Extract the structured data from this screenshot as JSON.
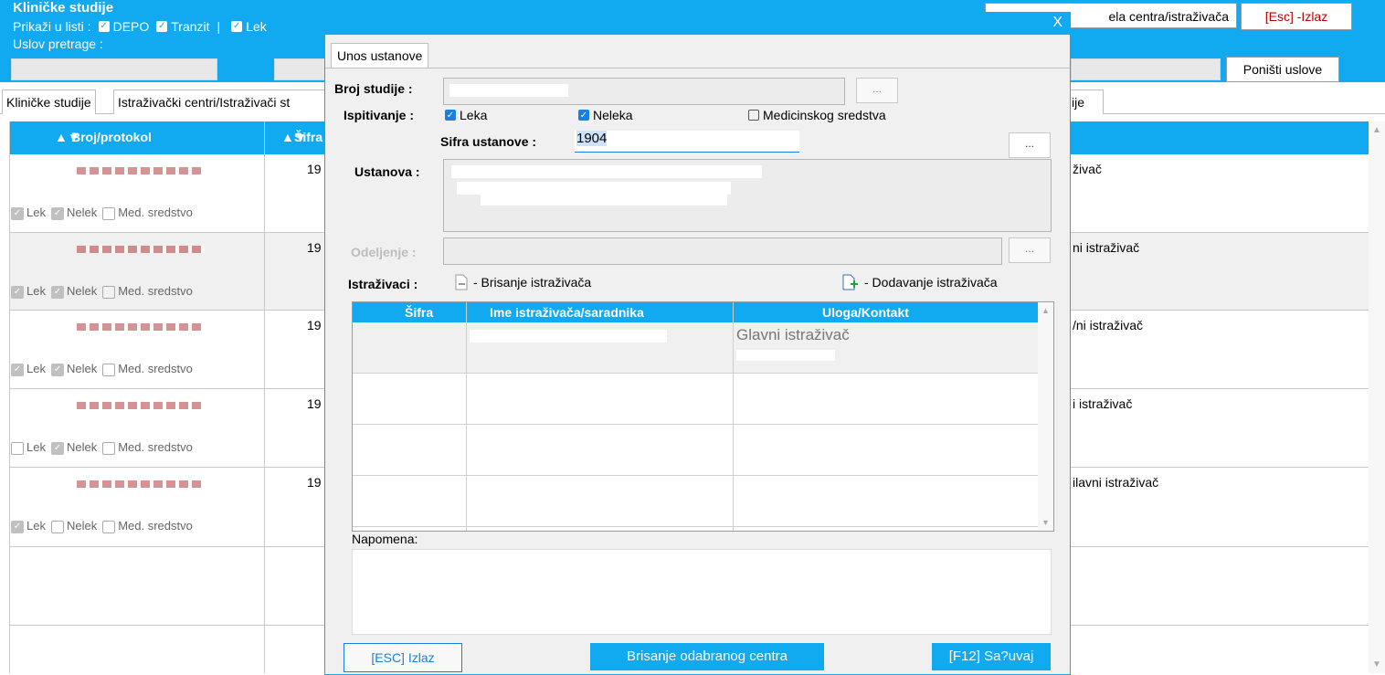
{
  "app": {
    "title": "Kliničke studije",
    "filter_label": "Prikaži u listi :",
    "filters": [
      "DEPO",
      "Tranzit",
      "Lek"
    ],
    "filter_separator": "|",
    "search_condition_label": "Uslov pretrage :"
  },
  "top_buttons": {
    "centers": "ela centra/istraživača",
    "exit": "[Esc] -Izlaz",
    "reset": "Poništi uslove"
  },
  "tabs": [
    "Kliničke studije",
    "Istraživački centri/Istraživači st",
    "ije"
  ],
  "grid": {
    "columns": [
      "Broj/protokol",
      "Šifra"
    ],
    "rows": [
      {
        "sifra": "19",
        "role": "živač",
        "lek": true,
        "nelek": true,
        "med": false
      },
      {
        "sifra": "19",
        "role": "ni istraživač",
        "lek": true,
        "nelek": true,
        "med": false
      },
      {
        "sifra": "19",
        "role": "/ni istraživač",
        "lek": true,
        "nelek": true,
        "med": false
      },
      {
        "sifra": "19",
        "role": "i istraživač",
        "lek": false,
        "nelek": true,
        "med": false
      },
      {
        "sifra": "19",
        "role": "ilavni istraživač",
        "lek": true,
        "nelek": false,
        "med": false
      }
    ],
    "checkbox_labels": {
      "lek": "Lek",
      "nelek": "Nelek",
      "med": "Med. sredstvo"
    }
  },
  "modal": {
    "close": "X",
    "tab": "Unos ustanove",
    "broj_studije_label": "Broj studije :",
    "ispitivanje_label": "Ispitivanje :",
    "ispitivanje_options": [
      {
        "label": "Leka",
        "checked": true
      },
      {
        "label": "Neleka",
        "checked": true
      },
      {
        "label": "Medicinskog sredstva",
        "checked": false
      }
    ],
    "sifra_label": "Sifra  ustanove :",
    "sifra_value": "1904",
    "ustanova_label": "Ustanova :",
    "odeljenje_label": "Odeljenje :",
    "ellipsis": "...",
    "istrazivaci_label": "Istraživaci :",
    "brisanje_istrazivaca": "- Brisanje istraživača",
    "dodavanje_istrazivaca": "- Dodavanje istraživača",
    "inv_columns": [
      "Šifra",
      "Ime istraživača/saradnika",
      "Uloga/Kontakt"
    ],
    "inv_row_role": "Glavni istraživač",
    "napomena_label": "Napomena:",
    "btn_esc": "[ESC] Izlaz",
    "btn_delete_center": "Brisanje odabranog centra",
    "btn_save": "[F12] Sa?uvaj"
  },
  "colors": {
    "accent": "#11aaf0",
    "checkbox": "#1a7fe0"
  }
}
